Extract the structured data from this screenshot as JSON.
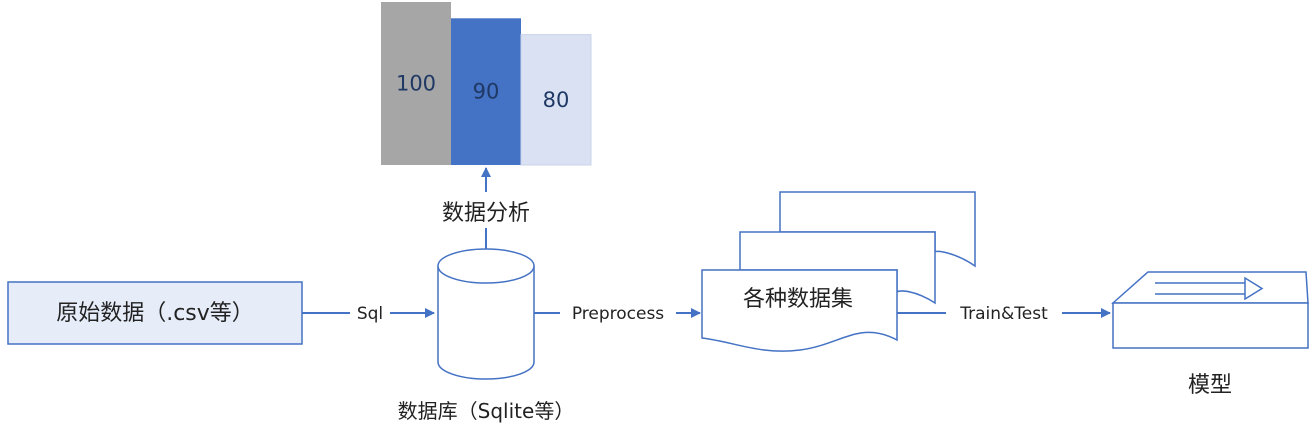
{
  "colors": {
    "line": "#4472c4",
    "box_fill": "#e6ecf8",
    "stroke": "#4472c4",
    "bar_gray": "#a6a6a6",
    "bar_blue": "#4472c4",
    "bar_light": "#d9e1f2",
    "text": "#222222",
    "bar_text_dark": "#1f3864"
  },
  "source_box": {
    "label": "原始数据（.csv等）"
  },
  "database": {
    "label": "数据库（Sqlite等）"
  },
  "datasets": {
    "label": "各种数据集"
  },
  "model": {
    "label": "模型",
    "icon": "router-arrow-icon"
  },
  "edges": {
    "sql": "Sql",
    "preprocess": "Preprocess",
    "train_test": "Train&Test",
    "analysis": "数据分析"
  },
  "chart_data": {
    "type": "bar",
    "categories": [
      "",
      "",
      ""
    ],
    "values": [
      100,
      90,
      80
    ],
    "data_labels": [
      "100",
      "90",
      "80"
    ]
  }
}
